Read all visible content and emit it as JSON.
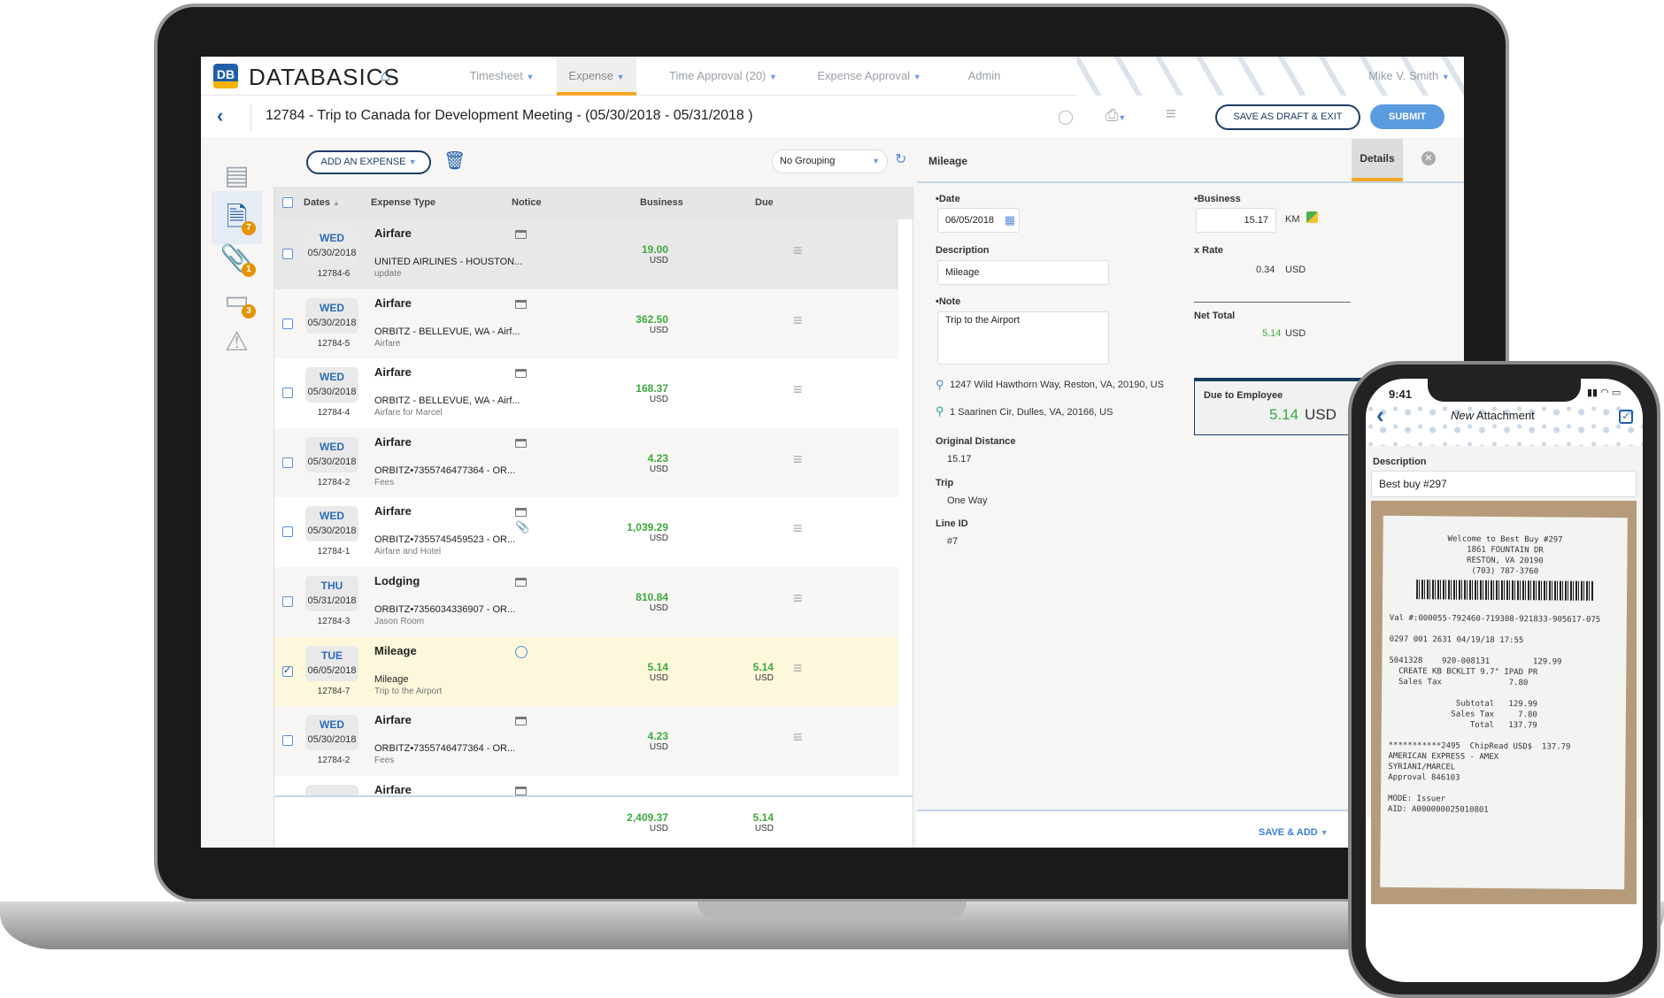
{
  "colors": {
    "accent": "#1f5fa8",
    "green": "#3da83d",
    "orange": "#f5a623",
    "submit": "#5b9be0"
  },
  "nav": {
    "brand": "DATABASICS",
    "logo_text": "DB",
    "items": [
      {
        "label": "Timesheet",
        "caret": true
      },
      {
        "label": "Expense",
        "caret": true,
        "active": true
      },
      {
        "label": "Time Approval (20)",
        "caret": true
      },
      {
        "label": "Expense Approval",
        "caret": true
      },
      {
        "label": "Admin"
      }
    ],
    "user": "Mike V. Smith"
  },
  "titlebar": {
    "title": "12784 - Trip to Canada for Development Meeting - (05/30/2018 - 05/31/2018 )",
    "save_draft": "SAVE AS DRAFT & EXIT",
    "submit": "SUBMIT"
  },
  "sidebar": {
    "items": [
      {
        "icon": "document-icon"
      },
      {
        "icon": "expense-report-icon",
        "badge": "7",
        "active": true
      },
      {
        "icon": "paperclip-icon",
        "badge": "1"
      },
      {
        "icon": "credit-card-icon",
        "badge": "3"
      },
      {
        "icon": "warning-icon"
      }
    ]
  },
  "toolbar": {
    "add_expense": "ADD AN EXPENSE",
    "grouping": "No Grouping"
  },
  "table": {
    "headers": {
      "dates": "Dates",
      "type": "Expense Type",
      "notice": "Notice",
      "business": "Business",
      "due": "Due"
    },
    "rows": [
      {
        "day": "WED",
        "date": "05/30/2018",
        "id": "12784-6",
        "type": "Airfare",
        "desc": "UNITED AIRLINES - HOUSTON...",
        "sub": "update",
        "notice": "card",
        "business": "19.00",
        "cur": "USD",
        "due": "",
        "checked": false
      },
      {
        "day": "WED",
        "date": "05/30/2018",
        "id": "12784-5",
        "type": "Airfare",
        "desc": "ORBITZ - BELLEVUE, WA - Airf...",
        "sub": "Airfare",
        "notice": "card",
        "business": "362.50",
        "cur": "USD",
        "due": "",
        "checked": false
      },
      {
        "day": "WED",
        "date": "05/30/2018",
        "id": "12784-4",
        "type": "Airfare",
        "desc": "ORBITZ - BELLEVUE, WA - Airf...",
        "sub": "Airfare for Marcel",
        "notice": "card",
        "business": "168.37",
        "cur": "USD",
        "due": "",
        "checked": false
      },
      {
        "day": "WED",
        "date": "05/30/2018",
        "id": "12784-2",
        "type": "Airfare",
        "desc": "ORBITZ•7355746477364 - OR...",
        "sub": "Fees",
        "notice": "card",
        "business": "4.23",
        "cur": "USD",
        "due": "",
        "checked": false
      },
      {
        "day": "WED",
        "date": "05/30/2018",
        "id": "12784-1",
        "type": "Airfare",
        "desc": "ORBITZ•7355745459523 - OR...",
        "sub": "Airfare and Hotel",
        "notice": "card+clip",
        "business": "1,039.29",
        "cur": "USD",
        "due": "",
        "checked": false
      },
      {
        "day": "THU",
        "date": "05/31/2018",
        "id": "12784-3",
        "type": "Lodging",
        "desc": "ORBITZ•7356034336907 - OR...",
        "sub": "Jason Room",
        "notice": "card",
        "business": "810.84",
        "cur": "USD",
        "due": "",
        "checked": false
      },
      {
        "day": "TUE",
        "date": "06/05/2018",
        "id": "12784-7",
        "type": "Mileage",
        "desc": "Mileage",
        "sub": "Trip to the Airport",
        "notice": "gauge",
        "business": "5.14",
        "cur": "USD",
        "due": "5.14",
        "checked": true
      },
      {
        "day": "WED",
        "date": "05/30/2018",
        "id": "12784-2",
        "type": "Airfare",
        "desc": "ORBITZ•7355746477364 - OR...",
        "sub": "Fees",
        "notice": "card",
        "business": "4.23",
        "cur": "USD",
        "due": "",
        "checked": false
      },
      {
        "day": "",
        "date": "",
        "id": "",
        "type": "Airfare",
        "desc": "",
        "sub": "",
        "notice": "card",
        "business": "",
        "cur": "",
        "due": "",
        "checked": false
      }
    ],
    "totals": {
      "business": "2,409.37",
      "due": "5.14",
      "cur": "USD"
    }
  },
  "detail": {
    "title": "Mileage",
    "tab": "Details",
    "date_label": "•Date",
    "date": "06/05/2018",
    "desc_label": "Description",
    "desc": "Mileage",
    "note_label": "•Note",
    "note": "Trip to the Airport",
    "from": "1247 Wild Hawthorn Way, Reston, VA, 20190, US",
    "to": "1 Saarinen Cir, Dulles, VA, 20166, US",
    "orig_label": "Original Distance",
    "orig": "15.17",
    "trip_label": "Trip",
    "trip": "One Way",
    "line_label": "Line ID",
    "line": "#7",
    "business_label": "•Business",
    "business": "15.17",
    "unit": "KM",
    "rate_label": "x Rate",
    "rate": "0.34",
    "rate_cur": "USD",
    "net_label": "Net Total",
    "net": "5.14",
    "net_cur": "USD",
    "due_label": "Due to Employee",
    "due": "5.14",
    "due_cur": "USD",
    "save_add": "SAVE & ADD"
  },
  "phone": {
    "time": "9:41",
    "title_italic": "New",
    "title": "Attachment",
    "desc_label": "Description",
    "desc": "Best buy #297",
    "receipt": [
      "Welcome to Best Buy #297",
      "1861 FOUNTAIN DR",
      "RESTON, VA 20190",
      "(703) 787-3760",
      "",
      "Val #:000055-792460-719308-921833-905617-075",
      "",
      "0297 001 2631 04/19/18 17:55",
      "",
      "5041328    920-008131         129.99",
      "  CREATE KB BCKLIT 9.7\" IPAD PR",
      "  Sales Tax              7.80",
      "",
      "              Subtotal   129.99",
      "             Sales Tax     7.80",
      "                 Total   137.79",
      "",
      "***********2495  ChipRead USD$  137.79",
      "AMERICAN EXPRESS - AMEX",
      "SYRIANI/MARCEL",
      "Approval 846103",
      "",
      "MODE: Issuer",
      "AID: A000000025010801"
    ]
  }
}
